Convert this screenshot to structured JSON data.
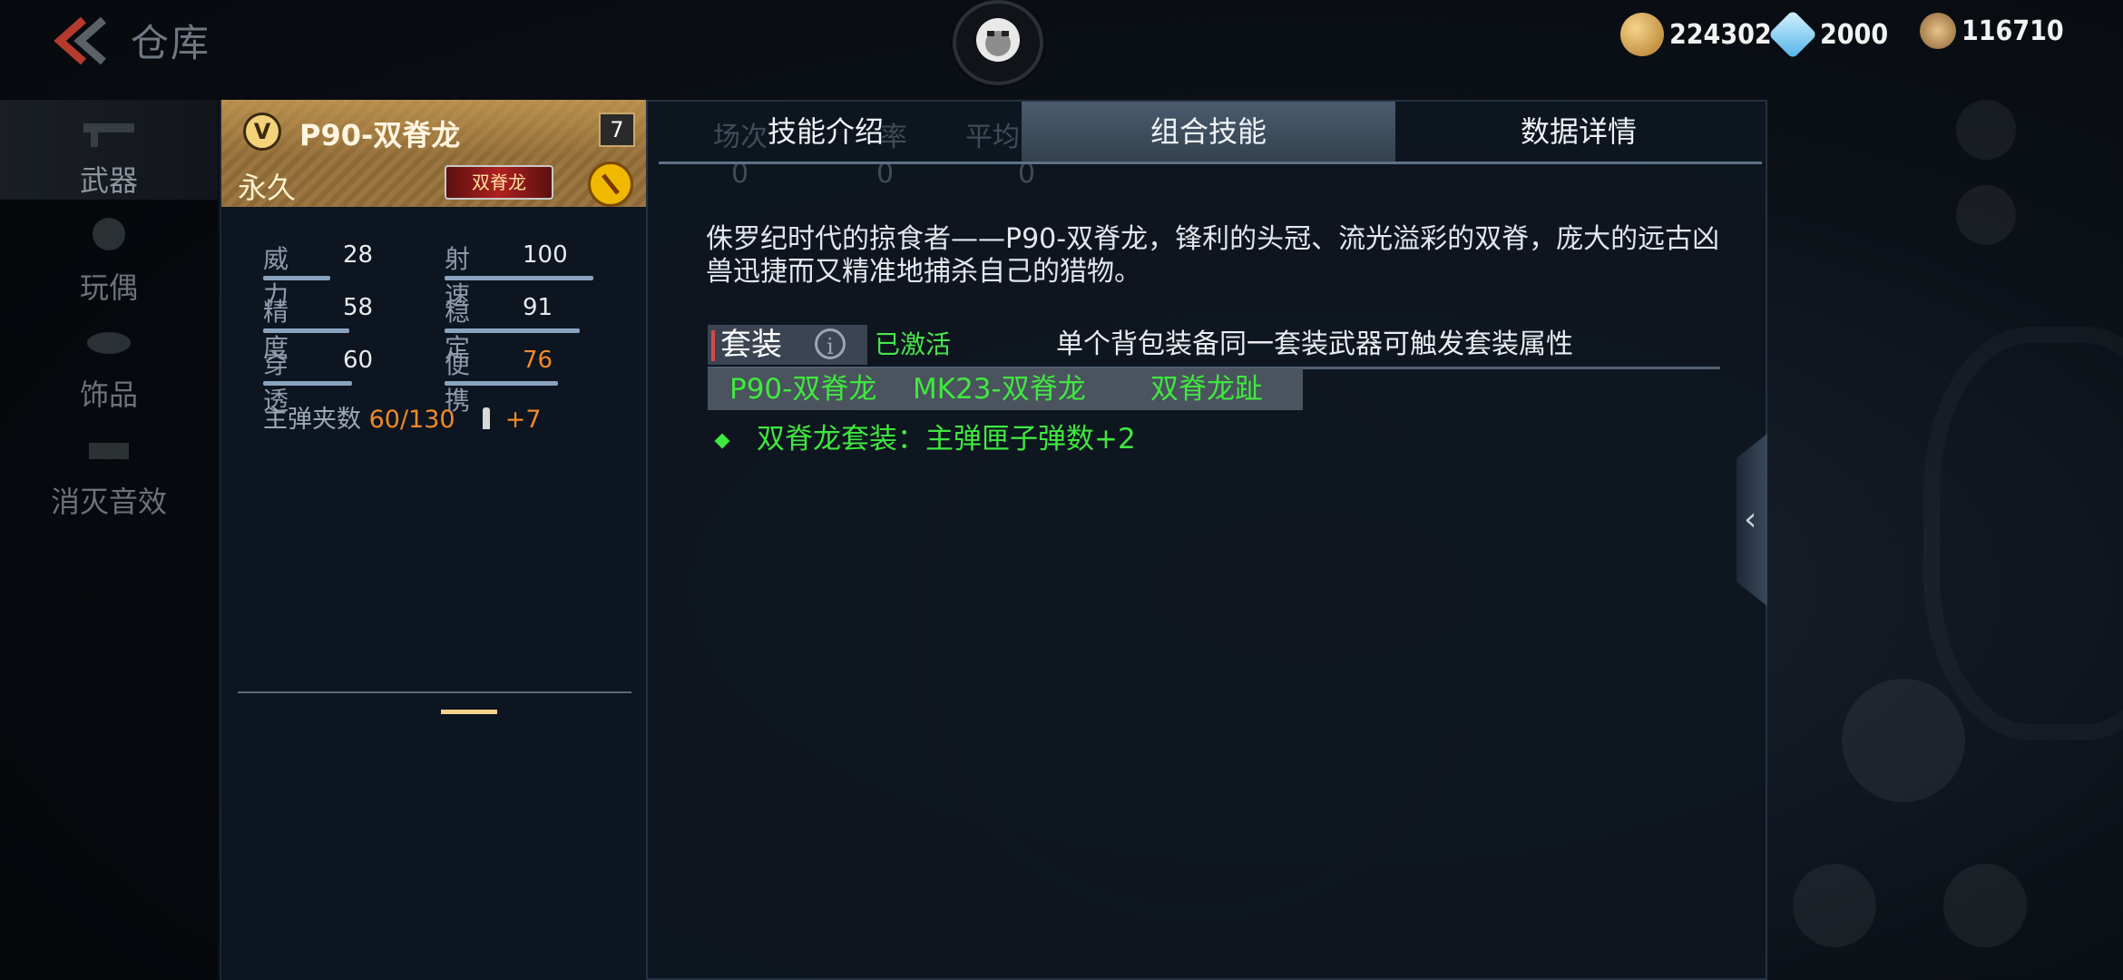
{
  "topbar": {
    "title": "仓库",
    "currencies": [
      {
        "name": "gold-coin",
        "value": "224302",
        "color": "#e0b55a"
      },
      {
        "name": "diamond",
        "value": "2000",
        "color": "#7fd4ff"
      },
      {
        "name": "honor-coin",
        "value": "116710",
        "color": "#d6b27a"
      }
    ]
  },
  "sidebar": {
    "items": [
      {
        "label": "武器",
        "icon": "rifle-icon",
        "active": true
      },
      {
        "label": "玩偶",
        "icon": "doll-icon",
        "active": false
      },
      {
        "label": "饰品",
        "icon": "accessory-icon",
        "active": false
      },
      {
        "label": "消灭音效",
        "icon": "sound-icon",
        "active": false
      }
    ]
  },
  "weapon": {
    "vip_mark": "V",
    "name": "P90-双脊龙",
    "level": "7",
    "duration": "永久",
    "skin_badge": "双脊龙",
    "stats": [
      {
        "name": "威力",
        "value": "28",
        "level": 0.28
      },
      {
        "name": "射速",
        "value": "100",
        "level": 1.0
      },
      {
        "name": "精度",
        "value": "58",
        "level": 0.58
      },
      {
        "name": "稳定",
        "value": "91",
        "level": 0.91
      },
      {
        "name": "穿透",
        "value": "60",
        "level": 0.6
      },
      {
        "name": "便携",
        "value": "76",
        "level": 0.76
      }
    ],
    "ammo_label": "主弹夹数",
    "ammo_value": "60/130",
    "ammo_bonus": "+7"
  },
  "main": {
    "ghost_headers": [
      "场次",
      "率",
      "平均KDA"
    ],
    "ghost_values": [
      "0",
      "0",
      "0"
    ],
    "tabs": [
      {
        "label": "技能介绍",
        "active": false
      },
      {
        "label": "组合技能",
        "active": true
      },
      {
        "label": "数据详情",
        "active": false
      }
    ],
    "description": "侏罗纪时代的掠食者——P90-双脊龙，锋利的头冠、流光溢彩的双脊，庞大的远古凶兽迅捷而又精准地捕杀自己的猎物。",
    "suit": {
      "label": "套装",
      "status": "已激活",
      "hint": "单个背包装备同一套装武器可触发套装属性",
      "members": [
        "P90-双脊龙",
        "MK23-双脊龙",
        "双脊龙趾"
      ],
      "bonus": "双脊龙套装：主弹匣子弹数+2"
    }
  }
}
